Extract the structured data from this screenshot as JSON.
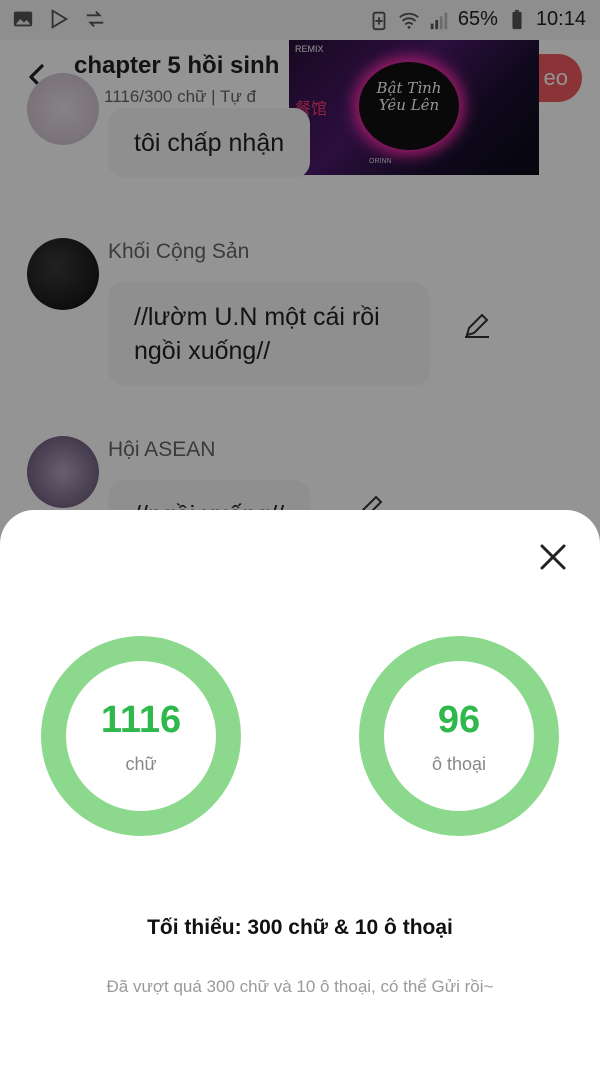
{
  "status_bar": {
    "battery": "65%",
    "time": "10:14"
  },
  "header": {
    "title": "chapter 5 hồi sinh",
    "progress": "1116/300 chữ | Tự đ",
    "publish_label": "eo"
  },
  "video_overlay": {
    "remix": "REMIX",
    "song_title": "Bật Tình Yêu Lên",
    "sign": "餐馆",
    "brand": "ORINN"
  },
  "messages": [
    {
      "sender": "",
      "text": "tôi chấp nhận"
    },
    {
      "sender": "Khối Cộng Sản",
      "text": "//lườm U.N một cái rồi ngồi xuống//"
    },
    {
      "sender": "Hội ASEAN",
      "text": "//ngồi xuống//"
    }
  ],
  "sheet": {
    "stats": [
      {
        "value": "1116",
        "label": "chữ"
      },
      {
        "value": "96",
        "label": "ô thoại"
      }
    ],
    "minimum": "Tối thiểu: 300 chữ & 10 ô thoại",
    "hint": "Đã vượt quá 300 chữ và 10 ô thoại, có thể Gửi rồi~"
  },
  "colors": {
    "ring": "#8cd98e",
    "number": "#2fb84b",
    "accent": "#f05a5f"
  },
  "icons": [
    "image-icon",
    "play-store-icon",
    "transfer-icon",
    "battery-saver-icon",
    "wifi-icon",
    "signal-icon",
    "battery-icon",
    "back-arrow-icon",
    "check-icon",
    "pencil-icon",
    "close-icon"
  ]
}
